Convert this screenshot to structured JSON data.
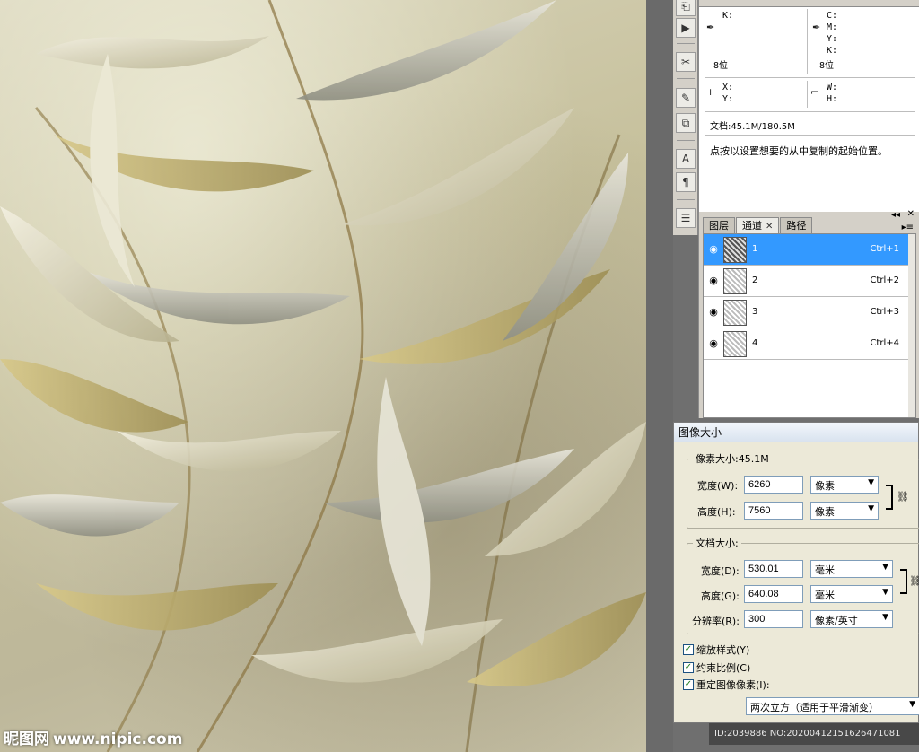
{
  "watermark": {
    "logo_text": "昵图网",
    "url": "www.nipic.com"
  },
  "info": {
    "k_left": "K:",
    "c_right": "C:",
    "m_right": "M:",
    "y_right": "Y:",
    "k_right": "K:",
    "bits_left": "8位",
    "bits_right": "8位",
    "x_label": "X:",
    "y_label": "Y:",
    "w_label": "W:",
    "h_label": "H:",
    "doc_size": "文档:45.1M/180.5M",
    "hint": "点按以设置想要的从中复制的起始位置。"
  },
  "channels": {
    "tabs": [
      {
        "label": "图层"
      },
      {
        "label": "通道"
      },
      {
        "label": "路径"
      }
    ],
    "items": [
      {
        "name": "1",
        "shortcut": "Ctrl+1"
      },
      {
        "name": "2",
        "shortcut": "Ctrl+2"
      },
      {
        "name": "3",
        "shortcut": "Ctrl+3"
      },
      {
        "name": "4",
        "shortcut": "Ctrl+4"
      }
    ]
  },
  "dialog": {
    "title": "图像大小",
    "pixel_legend": "像素大小:45.1M",
    "width_label": "宽度(W):",
    "width_value": "6260",
    "width_unit": "像素",
    "height_label": "高度(H):",
    "height_value": "7560",
    "height_unit": "像素",
    "doc_legend": "文档大小:",
    "doc_width_label": "宽度(D):",
    "doc_width_value": "530.01",
    "doc_width_unit": "毫米",
    "doc_height_label": "高度(G):",
    "doc_height_value": "640.08",
    "doc_height_unit": "毫米",
    "res_label": "分辨率(R):",
    "res_value": "300",
    "res_unit": "像素/英寸",
    "scale_styles": "缩放样式(Y)",
    "constrain": "约束比例(C)",
    "resample": "重定图像像素(I):",
    "resample_method": "两次立方（适用于平滑渐变）"
  },
  "id_strip": "ID:2039886 NO:20200412151626471081"
}
